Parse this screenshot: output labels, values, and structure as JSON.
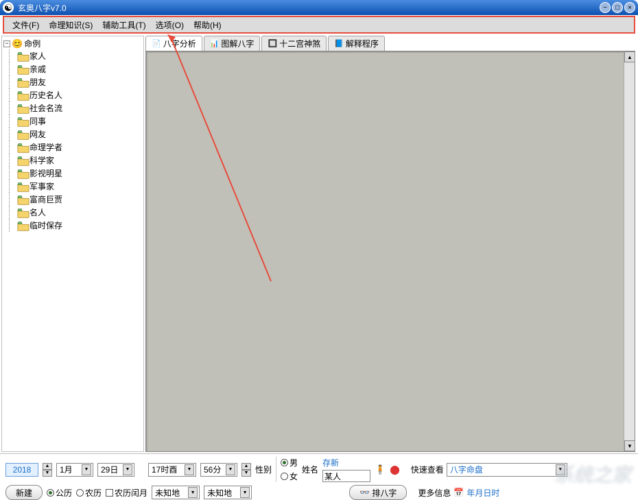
{
  "titlebar": {
    "title": "玄奥八字v7.0"
  },
  "menubar": {
    "file": "文件(F)",
    "knowledge": "命理知识(S)",
    "tools": "辅助工具(T)",
    "options": "选项(O)",
    "help": "帮助(H)"
  },
  "tree": {
    "root": "命例",
    "items": [
      "家人",
      "亲戚",
      "朋友",
      "历史名人",
      "社会名流",
      "同事",
      "网友",
      "命理学者",
      "科学家",
      "影视明星",
      "军事家",
      "富商巨贾",
      "名人",
      "临时保存"
    ]
  },
  "tabs": {
    "t1": "八字分析",
    "t2": "图解八字",
    "t3": "十二宫神煞",
    "t4": "解释程序"
  },
  "bottom": {
    "year": "2018",
    "month": "1月",
    "day": "29日",
    "hour": "17时酉",
    "minute": "56分",
    "new_btn": "新建",
    "cal_solar": "公历",
    "cal_lunar": "农历",
    "leap": "农历闰月",
    "place1": "未知地",
    "place2": "未知地",
    "gender_label": "性别",
    "male": "男",
    "female": "女",
    "name_label": "姓名",
    "name_value": "某人",
    "save_new": "存新",
    "pai_btn": "排八字",
    "quick_label": "快速查看",
    "quick_value": "八字命盘",
    "more_label": "更多信息",
    "more_value": "年月日时"
  }
}
